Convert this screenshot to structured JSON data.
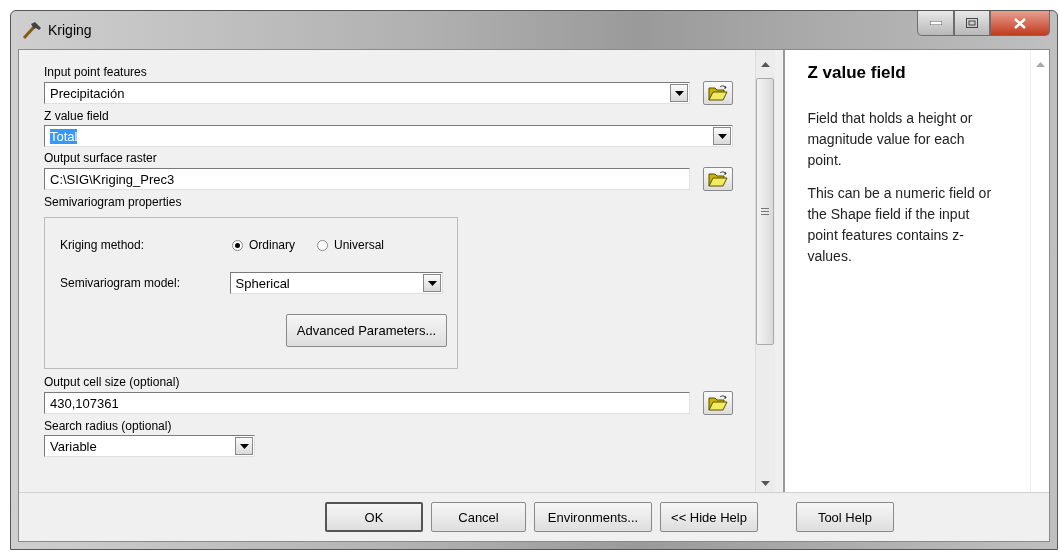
{
  "window": {
    "title": "Kriging"
  },
  "parameters": [
    {
      "kind": "combo_browse",
      "label": "Input point features",
      "value": "Precipitación",
      "highlighted": false
    },
    {
      "kind": "combo",
      "label": "Z value field",
      "value": "Total",
      "highlighted": true
    },
    {
      "kind": "text_browse",
      "label": "Output surface raster",
      "value": "C:\\SIG\\Kriging_Prec3",
      "highlighted": false
    },
    {
      "kind": "group",
      "label": "Semivariogram properties",
      "method_label": "Kriging method:",
      "methods": [
        {
          "label": "Ordinary",
          "selected": true
        },
        {
          "label": "Universal",
          "selected": false
        }
      ],
      "model_label": "Semivariogram model:",
      "model": "Spherical",
      "button": "Advanced Parameters..."
    },
    {
      "kind": "text_browse",
      "label": "Output cell size (optional)",
      "value": "430,107361",
      "highlighted": false
    },
    {
      "kind": "combo_short",
      "label": "Search radius (optional)",
      "value": "Variable",
      "highlighted": false
    }
  ],
  "help": {
    "title": "Z value field",
    "paragraphs": [
      "Field that holds a height or magnitude value for each point.",
      "This can be a numeric field or the Shape field if the input point features contains z-values."
    ]
  },
  "buttons": [
    {
      "label": "OK",
      "default": true
    },
    {
      "label": "Cancel",
      "default": false
    },
    {
      "label": "Environments...",
      "default": false
    },
    {
      "label": "<< Hide Help",
      "default": false
    },
    {
      "label": "Tool Help",
      "default": false
    }
  ]
}
